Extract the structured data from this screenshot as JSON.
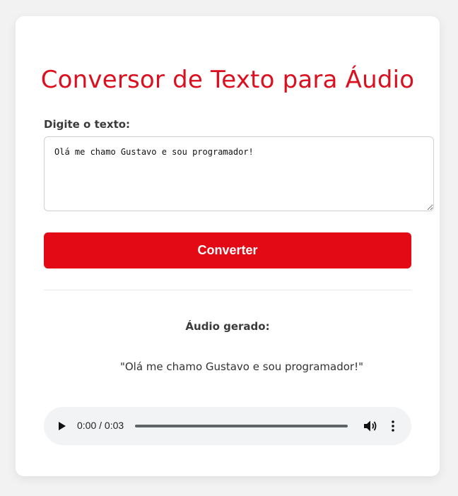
{
  "page": {
    "title": "Conversor de Texto para Áudio"
  },
  "form": {
    "label": "Digite o texto:",
    "text_value": "Olá me chamo Gustavo e sou programador!",
    "button_label": "Converter"
  },
  "result": {
    "label": "Áudio gerado:",
    "quote": "\"Olá me chamo Gustavo e sou programador!\""
  },
  "player": {
    "time": "0:00 / 0:03",
    "progress": 0,
    "icons": {
      "play": "play-icon",
      "volume": "volume-icon",
      "more": "more-options-icon"
    }
  },
  "colors": {
    "accent": "#e30a16",
    "title": "#dc0f1e",
    "background": "#f2f2f2",
    "card": "#ffffff",
    "player_bg": "#f1f3f4"
  }
}
